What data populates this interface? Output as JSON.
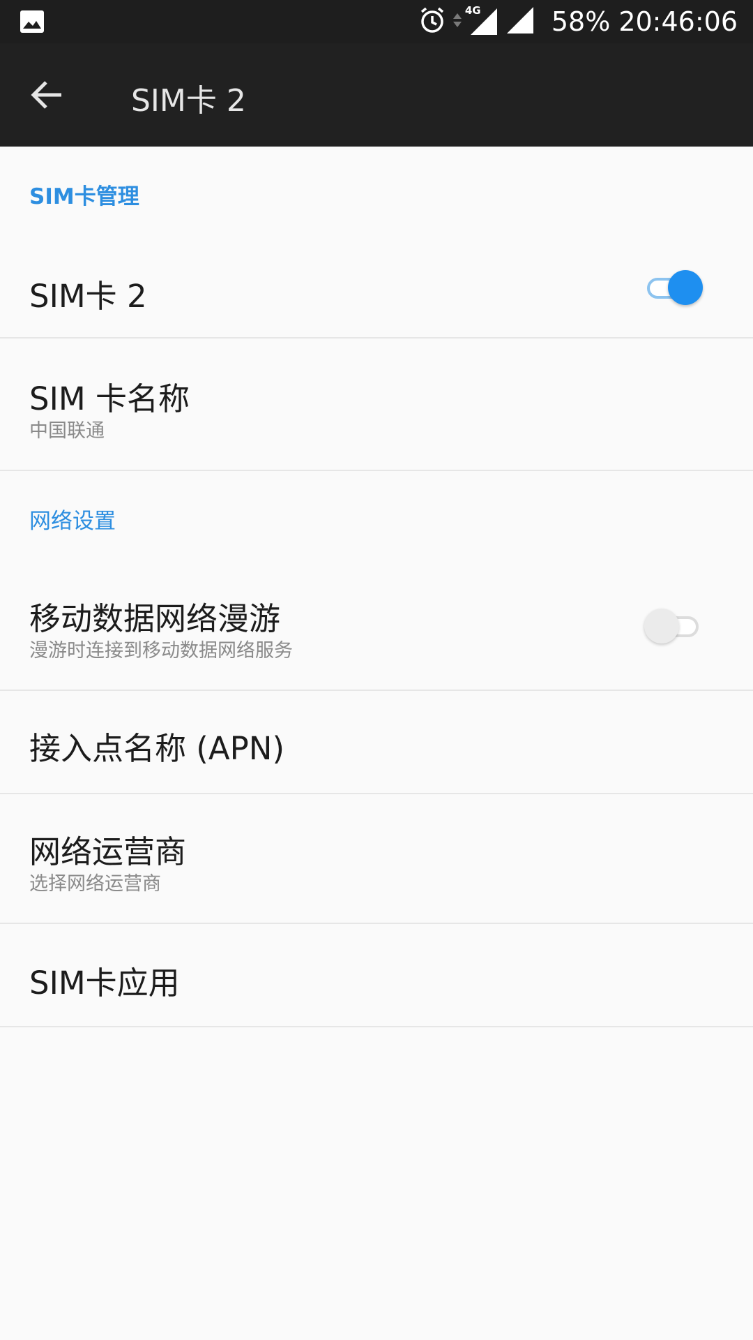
{
  "status_bar": {
    "battery": "58%",
    "time": "20:46:06",
    "network_type": "4G",
    "icons": [
      "gallery-icon",
      "alarm-icon",
      "data-arrows-icon",
      "signal-icon",
      "signal-icon"
    ]
  },
  "toolbar": {
    "title": "SIM卡 2",
    "back_icon": "arrow-left-icon"
  },
  "sections": {
    "sim_management": "SIM卡管理",
    "network_settings": "网络设置"
  },
  "prefs": {
    "sim_toggle": {
      "title": "SIM卡 2",
      "checked": true
    },
    "sim_name": {
      "title": "SIM 卡名称",
      "summary": "中国联通"
    },
    "roaming": {
      "title": "移动数据网络漫游",
      "summary": "漫游时连接到移动数据网络服务",
      "checked": false
    },
    "apn": {
      "title": "接入点名称 (APN)"
    },
    "operator": {
      "title": "网络运营商",
      "summary": "选择网络运营商"
    },
    "sim_apps": {
      "title": "SIM卡应用"
    }
  },
  "colors": {
    "accent": "#2d8ee0",
    "toggle_on": "#1e8ff0",
    "toolbar_bg": "#212121",
    "status_bg": "#1e1e1e",
    "page_bg": "#fafafa"
  }
}
